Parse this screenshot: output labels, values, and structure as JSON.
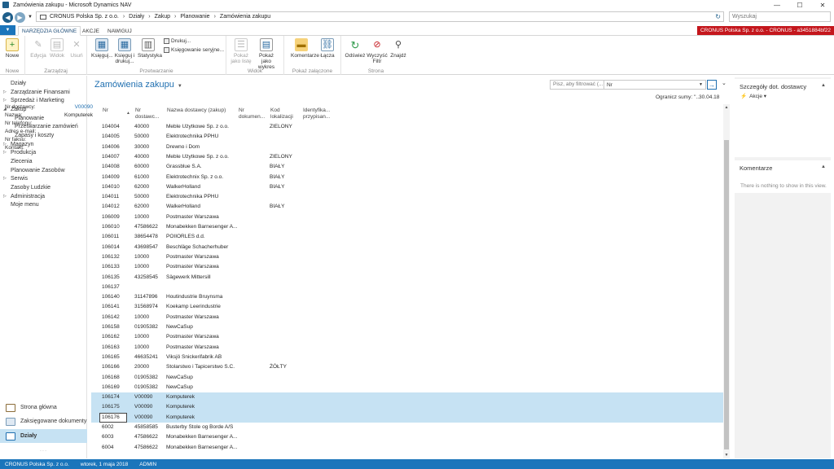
{
  "window": {
    "title": "Zamówienia zakupu - Microsoft Dynamics NAV",
    "min": "—",
    "max": "☐",
    "close": "✕"
  },
  "address": {
    "breadcrumbs": [
      "CRONUS Polska Sp. z o.o.",
      "Działy",
      "Zakup",
      "Planowanie",
      "Zamówienia zakupu"
    ],
    "search_placeholder": "Wyszukaj"
  },
  "ribbon_tabs": [
    "NARZĘDZIA GŁÓWNE",
    "AKCJE",
    "NAWIGUJ"
  ],
  "company_badge": "CRONUS Polska Sp. z o.o. - CRONUS - a3451884bf22",
  "ribbon": {
    "groups": [
      "Nowe",
      "Zarządzaj",
      "Przetwarzanie",
      "Widok",
      "Pokaż załączone",
      "Strona"
    ],
    "buttons": {
      "new": "Nowe",
      "edit": "Edycja",
      "view": "Widok",
      "delete": "Usuń",
      "post": "Księguj...",
      "post_print": "Księguj i drukuj...",
      "stats": "Statystyka",
      "print": "Drukuj...",
      "serial_post": "Księgowanie seryjne...",
      "show_list": "Pokaż jako listę",
      "show_chart": "Pokaż jako wykres",
      "comments": "Komentarze",
      "links": "Łącza",
      "refresh": "Odśwież",
      "clear_filter": "Wyczyść Filtr",
      "find": "Znajdź"
    }
  },
  "nav": {
    "items": [
      "Działy",
      "Zarządzanie Finansami",
      "Sprzedaż i Marketing",
      "Zakup",
      "Planowanie",
      "Przetwarzanie zamówień",
      "Zapasy i koszty",
      "Magazyn",
      "Produkcja",
      "Zlecenia",
      "Planowanie Zasobów",
      "Serwis",
      "Zasoby Ludzkie",
      "Administracja",
      "Moje menu"
    ],
    "bottom": [
      "Strona główna",
      "Zaksięgowane dokumenty",
      "Działy"
    ]
  },
  "list": {
    "title": "Zamówienia zakupu",
    "filter_placeholder": "Pisz, aby filtrować (...",
    "filter_field": "Nr",
    "sum_limit": "Ogranicz sumy: ''..30.04.18",
    "columns": [
      "Nr",
      "Nr dostawc...",
      "Nazwa dostawcy (zakup)",
      "Nr dokumen...",
      "Kod lokalizacji",
      "Identyfika... przypisan..."
    ],
    "rows": [
      [
        "104004",
        "40000",
        "Meble Użytkowe Sp. z o.o.",
        "ZIELONY"
      ],
      [
        "104005",
        "50000",
        "Elektrotechnika PPHU",
        ""
      ],
      [
        "104006",
        "30000",
        "Drewno i Dom",
        ""
      ],
      [
        "104007",
        "40000",
        "Meble Użytkowe Sp. z o.o.",
        "ZIELONY"
      ],
      [
        "104008",
        "60000",
        "Grassblue S.A.",
        "BIAŁY"
      ],
      [
        "104009",
        "61000",
        "Elektrotechnix Sp. z o.o.",
        "BIAŁY"
      ],
      [
        "104010",
        "62000",
        "WalkerHolland",
        "BIAŁY"
      ],
      [
        "104011",
        "50000",
        "Elektrotechnika PPHU",
        ""
      ],
      [
        "104012",
        "62000",
        "WalkerHolland",
        "BIAŁY"
      ],
      [
        "106009",
        "10000",
        "Postmaster Warszawa",
        ""
      ],
      [
        "106010",
        "47586622",
        "Monabekken Barnesenger A...",
        ""
      ],
      [
        "106011",
        "38654478",
        "POIIORLES d.d.",
        ""
      ],
      [
        "106014",
        "43698547",
        "Beschläge Schacherhuber",
        ""
      ],
      [
        "106132",
        "10000",
        "Postmaster Warszawa",
        ""
      ],
      [
        "106133",
        "10000",
        "Postmaster Warszawa",
        ""
      ],
      [
        "106135",
        "43258545",
        "Sägewerk Mittersill",
        ""
      ],
      [
        "106137",
        "",
        "",
        ""
      ],
      [
        "106140",
        "31147896",
        "Houtindustrie Bruynsma",
        ""
      ],
      [
        "106141",
        "31568974",
        "Koekamp Leerindustrie",
        ""
      ],
      [
        "106142",
        "10000",
        "Postmaster Warszawa",
        ""
      ],
      [
        "106158",
        "01905382",
        "NewCaSup",
        ""
      ],
      [
        "106162",
        "10000",
        "Postmaster Warszawa",
        ""
      ],
      [
        "106163",
        "10000",
        "Postmaster Warszawa",
        ""
      ],
      [
        "106165",
        "46635241",
        "Viksjö Snickerifabrik AB",
        ""
      ],
      [
        "106166",
        "20000",
        "Stolarstwo i Tapicerstwo S.C.",
        "ŻÓŁTY"
      ],
      [
        "106168",
        "01905382",
        "NewCaSup",
        ""
      ],
      [
        "106169",
        "01905382",
        "NewCaSup",
        ""
      ],
      [
        "106174",
        "V00090",
        "Komputerek",
        ""
      ],
      [
        "106175",
        "V00090",
        "Komputerek",
        ""
      ],
      [
        "106176",
        "V00090",
        "Komputerek",
        ""
      ],
      [
        "6002",
        "45858585",
        "Busterby Stole og Borde A/S",
        ""
      ],
      [
        "6003",
        "47586622",
        "Monabekken Barnesenger A...",
        ""
      ],
      [
        "6004",
        "47586622",
        "Monabekken Barnesenger A...",
        ""
      ]
    ],
    "selected_rows": [
      "106174",
      "106175",
      "106176"
    ],
    "current_row": "106176"
  },
  "factbox": {
    "vendor_title": "Szczegóły dot. dostawcy",
    "actions_label": "Akcje",
    "fields": [
      {
        "label": "Nr dostawcy:",
        "value": "V00090"
      },
      {
        "label": "Nazwa:",
        "value": "Komputerek"
      },
      {
        "label": "Nr telefonu:",
        "value": ""
      },
      {
        "label": "Adres e-mail:",
        "value": ""
      },
      {
        "label": "Nr faksu:",
        "value": ""
      },
      {
        "label": "Kontakt:",
        "value": ""
      }
    ],
    "comments_title": "Komentarze",
    "comments_empty": "There is nothing to show in this view."
  },
  "status": {
    "company": "CRONUS Polska Sp. z o.o.",
    "date": "wtorek, 1 maja 2018",
    "user": "ADMIN"
  }
}
